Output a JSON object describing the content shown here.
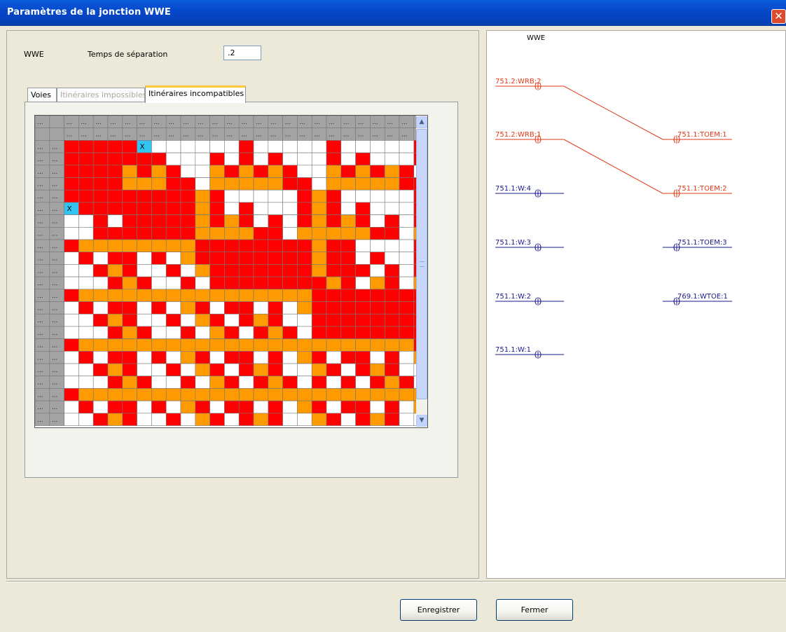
{
  "window": {
    "title": "Paramètres de la jonction WWE",
    "close_glyph": "✕"
  },
  "form": {
    "junction_name": "WWE",
    "separation_label": "Temps de séparation",
    "separation_value": ".2"
  },
  "tabs": [
    {
      "label": "Voies",
      "state": "normal"
    },
    {
      "label": "Itinéraires impossibles",
      "state": "disabled"
    },
    {
      "label": "Itinéraires incompatibles",
      "state": "active"
    }
  ],
  "matrix": {
    "header_cell_text": "...",
    "marked_cell_text": "X",
    "legend_colors": {
      "header": "#a3a3a3",
      "red": "#ff0000",
      "orange": "#ff9a00",
      "white": "#ffffff",
      "selected": "#33c3f0",
      "gridline": "#777777"
    },
    "rows": [
      "RRRRRX......R.....R.....R...",
      "RRRRRRR...R.R.R...R.R...R.R.",
      "RRRROROR..OROROR..OROROR..OR",
      "RRRROOORR.OOOOORR.OOOOORR.OO",
      "RRRRRRRRROR.....ROR.....ROR.",
      "XRRRRRRRROR.R...ROR.R...ROR.",
      "..R.RRRRROROR.R.ROROR.R.ROR.",
      "..RRRRRRROOOORR.OOOOORR.OOOO",
      "ROOOOOOOORRRRRRRRORR....R.OR",
      ".R.RR.R.ORRRRRRRRORR.R..ROR.",
      "..ROR..R.ORRRRRRRORRR.R.RORR",
      "...ROR..R.RRRRRRRROR.OR.OROR",
      "ROOOOOOOOOOOOOOOORRRRRRRRORR",
      ".R.RR.R.OR.RR.R.ORRRRRRRR.RR",
      "..ROR..R.OR.ROR..RRRRRRRROR.",
      "...ROR..R.OR.ROR.RRRRRRRRR.R",
      "ROOOOOOOOOOOOOOOOOOOOOOORRRR",
      ".R.RR.R.OR.RR.R.OR.RR.R.ORRR",
      "..ROR..R.OR.ROR..OR.ROR..RRR",
      "...ROR..R.OR.ROR.R.R.ROR.RRR",
      "ROOOOOOOOOOOOOOOOOOOOOOOOORR",
      ".R.RR.R.OR.RR.R.OR.RR.R.ORRR",
      "..ROR..R.OR.ROR..OR.ROR..RRR"
    ]
  },
  "diagram": {
    "title": "WWE",
    "colors": {
      "active": "#e03a16",
      "inactive": "#1a1a8a"
    },
    "left_nodes": [
      {
        "label": "751.2:WRB:2",
        "color": "active"
      },
      {
        "label": "751.2:WRB:1",
        "color": "active"
      },
      {
        "label": "751.1:W:4",
        "color": "inactive"
      },
      {
        "label": "751.1:W:3",
        "color": "inactive"
      },
      {
        "label": "751.1:W:2",
        "color": "inactive"
      },
      {
        "label": "751.1:W:1",
        "color": "inactive"
      }
    ],
    "right_nodes": [
      {
        "label": "751.1:TOEM:1",
        "color": "active"
      },
      {
        "label": "751.1:TOEM:2",
        "color": "active"
      },
      {
        "label": "751.1:TOEM:3",
        "color": "inactive"
      },
      {
        "label": "769.1:WTOE:1",
        "color": "inactive"
      }
    ],
    "connections": [
      {
        "from": 0,
        "to": 0
      },
      {
        "from": 1,
        "to": 1
      }
    ]
  },
  "buttons": {
    "save": "Enregistrer",
    "close": "Fermer"
  }
}
